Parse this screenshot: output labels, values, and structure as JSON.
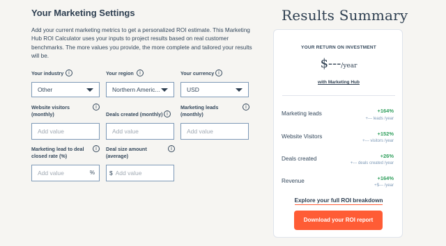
{
  "settings": {
    "title": "Your Marketing Settings",
    "description": "Add your current marketing metrics to get a personalized ROI estimate. This Marketing Hub ROI Calculator uses your inputs to project results based on real customer benchmarks. The more values you provide, the more complete and tailored your results will be."
  },
  "fields": {
    "industry": {
      "label": "Your industry",
      "value": "Other"
    },
    "region": {
      "label": "Your region",
      "value": "Northern Americ..."
    },
    "currency": {
      "label": "Your currency",
      "value": "USD"
    },
    "visitors": {
      "label_line1": "Website visitors",
      "label_line2": "(monthly)",
      "placeholder": "Add value"
    },
    "deals": {
      "label": "Deals created (monthly)",
      "placeholder": "Add value"
    },
    "leads": {
      "label_line1": "Marketing leads",
      "label_line2": "(monthly)",
      "placeholder": "Add value"
    },
    "close_rate": {
      "label_line1": "Marketing lead to deal",
      "label_line2": "closed rate (%)",
      "placeholder": "Add value",
      "suffix": "%"
    },
    "deal_size": {
      "label_line1": "Deal size amount",
      "label_line2": "(average)",
      "prefix": "$",
      "placeholder": "Add value"
    }
  },
  "summary": {
    "title": "Results Summary",
    "roi_label": "YOUR RETURN ON INVESTMENT",
    "roi_value": "$---",
    "roi_unit": "/year",
    "roi_sub": "with Marketing Hub",
    "metrics": [
      {
        "name": "Marketing leads",
        "pct": "+164%",
        "sub": "+--- leads /year"
      },
      {
        "name": "Website Visitors",
        "pct": "+152%",
        "sub": "+--- visitors /year"
      },
      {
        "name": "Deals created",
        "pct": "+26%",
        "sub": "+--- deals created /year"
      },
      {
        "name": "Revenue",
        "pct": "+164%",
        "sub": "+$--- /year"
      }
    ],
    "explore_link": "Explore your full ROI breakdown",
    "download_button": "Download your ROI report"
  },
  "icons": {
    "info": "info-icon",
    "caret": "chevron-down-icon"
  },
  "colors": {
    "accent": "#ff5c35",
    "positive": "#2e9e5b",
    "text": "#2d3e50"
  }
}
